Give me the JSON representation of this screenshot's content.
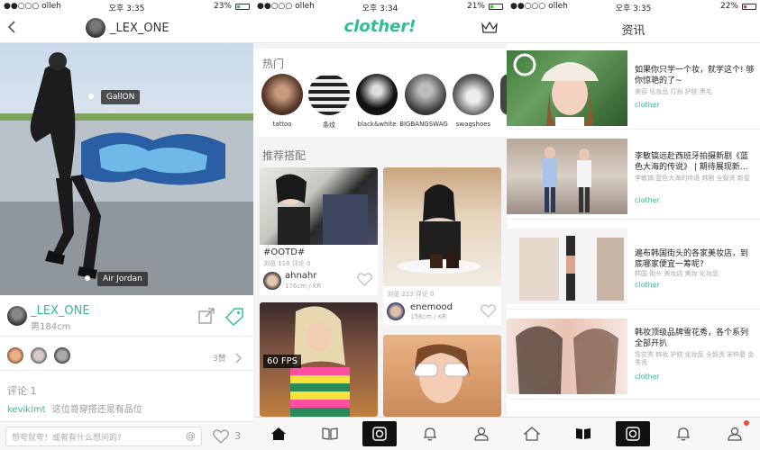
{
  "colors": {
    "accent": "#2bbf95",
    "notify": "#e84c3d"
  },
  "screen1": {
    "status": {
      "carrier": "●●○○○ olleh",
      "time": "오후 3:35",
      "battery": "23%",
      "battery_fill": 0.23
    },
    "nav": {
      "username": "_LEX_ONE",
      "back_icon": "chevron-left-icon"
    },
    "photo_tags": [
      {
        "label": "GallON"
      },
      {
        "label": "Air Jordan"
      }
    ],
    "user": {
      "name": "_LEX_ONE",
      "height": "男184cm"
    },
    "likes": {
      "count_label": "3赞"
    },
    "comments": {
      "title": "评论 1",
      "author": "kevikimt",
      "text": "这位哥穿搭还是有品位"
    },
    "input": {
      "placeholder": "想夸就夸！或者有什么想问的?",
      "at": "@",
      "like_count": "3"
    }
  },
  "screen2": {
    "status": {
      "carrier": "●●○○○ olleh",
      "time": "오후 3:34",
      "battery": "21%",
      "battery_fill": 0.21
    },
    "logo": "clother!",
    "hot": {
      "title": "热门",
      "items": [
        {
          "label": "tattoo"
        },
        {
          "label": "条纹"
        },
        {
          "label": "black&white"
        },
        {
          "label": "BIGBANGSWAG"
        },
        {
          "label": "swagshoes"
        }
      ]
    },
    "recommend": {
      "title": "推荐搭配"
    },
    "cards": [
      {
        "caption": "#OOTD#",
        "stats": "浏览 118  评论 0",
        "user": "ahnahr",
        "info": "176cm / KR"
      },
      {
        "caption": "",
        "stats": "浏览 223  评论 0",
        "user": "enemood",
        "info": "158cm / KR"
      }
    ],
    "fps": "60 FPS"
  },
  "screen3": {
    "status": {
      "carrier": "●●○○○ olleh",
      "time": "오후 3:35",
      "battery": "22%",
      "battery_fill": 0.22
    },
    "nav": {
      "title": "资讯"
    },
    "news": [
      {
        "title": "如果你只学一个妆，就学这个! 够你惊艳的了~",
        "tags": "美容 化妆品 打扮 护肤 黑毛",
        "source": "clother"
      },
      {
        "title": "李敏镐远赴西班牙拍摄新剧《蓝色大海的传说》 | 期待展现新…",
        "tags": "李敏镐 蓝色大海的传说 韩剧 全智贤 新星",
        "source": "clother"
      },
      {
        "title": "遍布韩国街头的各家美妆店，到底哪家便宜一筹呢?",
        "tags": "韩国 街头 美妆店 美妆 化妆品",
        "source": "clother"
      },
      {
        "title": "韩妆顶级品牌雪花秀，各个系列全部开扒",
        "tags": "雪花秀 韩妆 护肤 化妆品 全智贤 宋仲基 金秀贤",
        "source": "clother"
      }
    ]
  }
}
